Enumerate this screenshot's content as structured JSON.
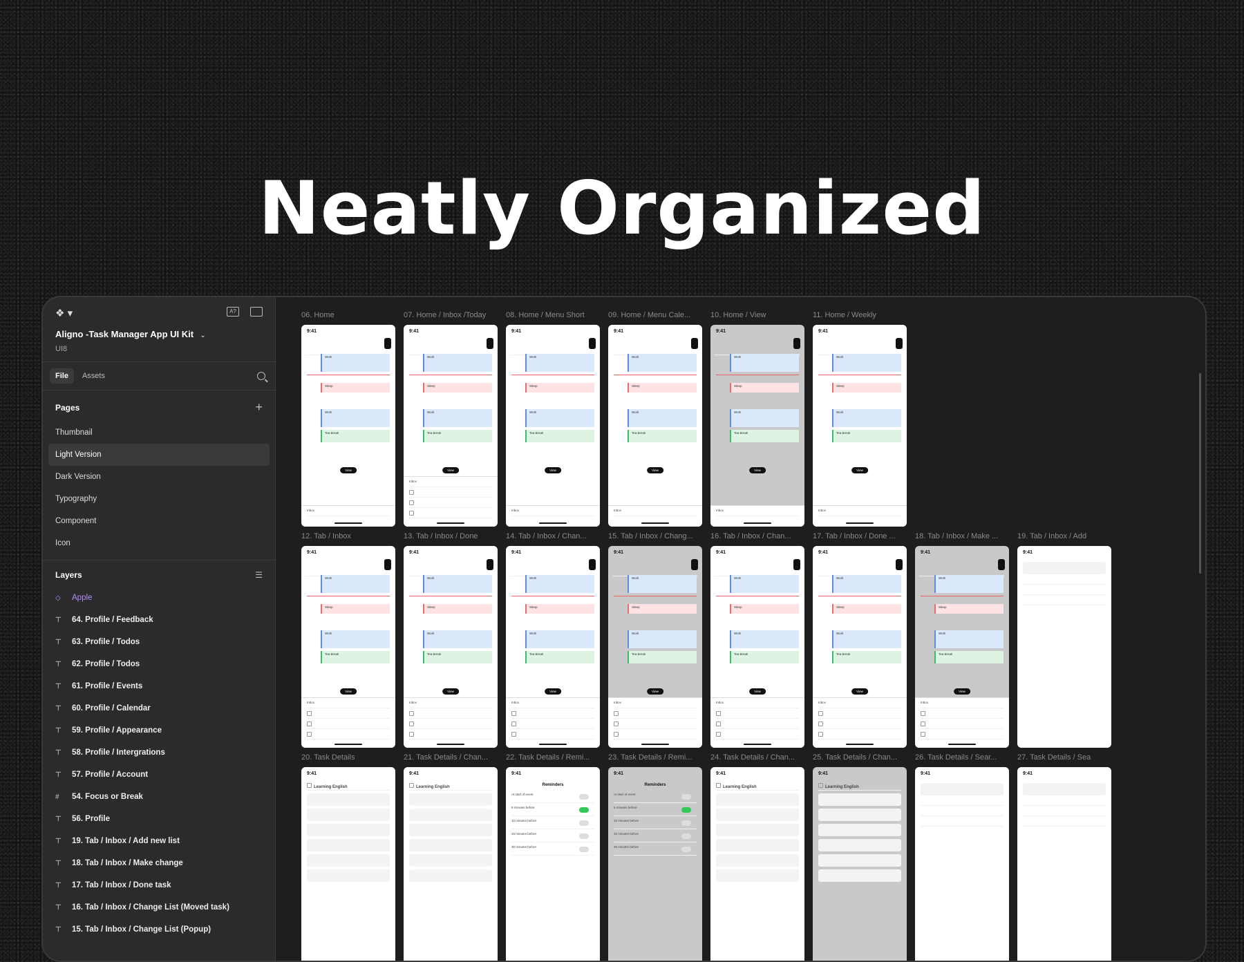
{
  "hero": {
    "title": "Neatly Organized"
  },
  "sidebar": {
    "project_title": "Aligno -Task Manager App UI Kit",
    "project_sub": "UI8",
    "tabs": [
      "File",
      "Assets"
    ],
    "pages_label": "Pages",
    "pages": [
      "Thumbnail",
      "Light Version",
      "Dark Version",
      "Typography",
      "Component",
      "Icon"
    ],
    "active_page": "Light Version",
    "layers_label": "Layers",
    "layers": [
      {
        "label": "Apple",
        "icon": "diamond-icon"
      },
      {
        "label": "64. Profile / Feedback",
        "icon": "frame-icon"
      },
      {
        "label": "63. Profile / Todos",
        "icon": "frame-icon"
      },
      {
        "label": "62. Profile / Todos",
        "icon": "frame-icon"
      },
      {
        "label": "61. Profile / Events",
        "icon": "frame-icon"
      },
      {
        "label": "60. Profile / Calendar",
        "icon": "frame-icon"
      },
      {
        "label": "59. Profile / Appearance",
        "icon": "frame-icon"
      },
      {
        "label": "58. Profile / Intergrations",
        "icon": "frame-icon"
      },
      {
        "label": "57. Profile / Account",
        "icon": "frame-icon"
      },
      {
        "label": "54. Focus or Break",
        "icon": "hash-icon"
      },
      {
        "label": "56. Profile",
        "icon": "frame-icon"
      },
      {
        "label": "19. Tab / Inbox / Add new list",
        "icon": "frame-icon"
      },
      {
        "label": "18. Tab / Inbox / Make change",
        "icon": "frame-icon"
      },
      {
        "label": "17. Tab / Inbox / Done task",
        "icon": "frame-icon"
      },
      {
        "label": "16. Tab / Inbox / Change List (Moved task)",
        "icon": "frame-icon"
      },
      {
        "label": "15. Tab / Inbox / Change List (Popup)",
        "icon": "frame-icon"
      }
    ]
  },
  "canvas": {
    "row1": [
      "06. Home",
      "07. Home / Inbox /Today",
      "08. Home / Menu Short",
      "09. Home / Menu Cale...",
      "10. Home / View",
      "11. Home / Weekly"
    ],
    "row2": [
      "12. Tab / Inbox",
      "13. Tab / Inbox / Done",
      "14. Tab / Inbox / Chan...",
      "15. Tab / Inbox / Chang...",
      "16. Tab / Inbox / Chan...",
      "17. Tab / Inbox / Done ...",
      "18. Tab / Inbox / Make ...",
      "19. Tab / Inbox / Add"
    ],
    "row3": [
      "20. Task Details",
      "21. Task Details / Chan...",
      "22. Task Details / Remi...",
      "23. Task Details / Remi...",
      "24. Task Details / Chan...",
      "25. Task Details / Chan...",
      "26. Task Details / Sear...",
      "27. Task Details / Sea"
    ],
    "phone": {
      "time": "9:41",
      "ev_work": "Work",
      "ev_sleep": "Sleep",
      "ev_study": "Study",
      "ev_tea": "Tea Break",
      "view_pill": "View",
      "inbox": "Inbox",
      "task_title": "Learning English",
      "reminders": "Reminders",
      "rem_items": [
        "At start of event",
        "5 minutes before",
        "10 minutes before",
        "15 minutes before",
        "30 minutes before"
      ]
    }
  }
}
